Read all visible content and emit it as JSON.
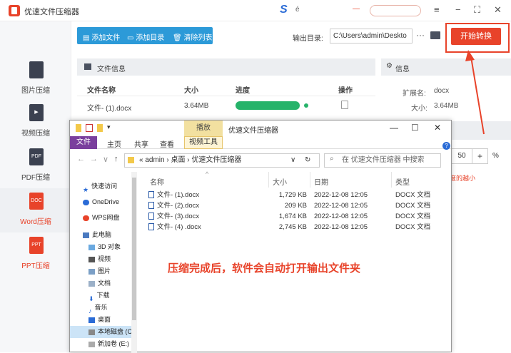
{
  "app": {
    "title": "优速文件压缩器",
    "brand_color": "#e8432a",
    "tb_e_char": "é"
  },
  "window_controls": {
    "menu": "≡",
    "minimize": "−",
    "maximize": "⛶",
    "close": "✕"
  },
  "sidebar": {
    "items": [
      {
        "label": "图片压缩",
        "icon": "image-icon",
        "active": false
      },
      {
        "label": "视频压缩",
        "icon": "video-icon",
        "active": false
      },
      {
        "label": "PDF压缩",
        "icon": "pdf-icon",
        "icon_text": "PDF",
        "active": false
      },
      {
        "label": "Word压缩",
        "icon": "word-icon",
        "icon_text": "DOC",
        "active": true
      },
      {
        "label": "PPT压缩",
        "icon": "ppt-icon",
        "icon_text": "PPT",
        "active": false
      }
    ]
  },
  "toolbar": {
    "add_file": "添加文件",
    "add_dir": "添加目录",
    "clear_list": "清除列表",
    "output_label": "输出目录:",
    "output_path": "C:\\Users\\admin\\Deskto",
    "more": "···",
    "start_button": "开始转换"
  },
  "file_panel": {
    "title": "文件信息",
    "columns": [
      "文件名称",
      "大小",
      "进度",
      "操作"
    ],
    "rows": [
      {
        "name": "文件- (1).docx",
        "size": "3.64MB",
        "progress": 1.0
      }
    ]
  },
  "info_panel": {
    "title": "信息",
    "ext_label": "扩展名:",
    "ext_value": "docx",
    "size_label": "大小:",
    "size_value": "3.64MB",
    "level_value": "50",
    "plus": "+",
    "percent": "%",
    "hint": "度的越小",
    "help": "?"
  },
  "explorer": {
    "title": "优速文件压缩器",
    "manage_tab": "播放",
    "tabs": [
      "文件",
      "主页",
      "共享",
      "查看",
      "视频工具"
    ],
    "address": [
      "«",
      "admin",
      "›",
      "桌面",
      "›",
      "优速文件压缩器"
    ],
    "search_placeholder": "在 优速文件压缩器 中搜索",
    "nav": [
      {
        "label": "快速访问",
        "icon": "star-icon"
      },
      {
        "label": "OneDrive",
        "icon": "cloud-icon"
      },
      {
        "label": "WPS网盘",
        "icon": "wps-cloud-icon"
      },
      {
        "label": "此电脑",
        "icon": "computer-icon"
      },
      {
        "label": "3D 对象",
        "icon": "cube-icon"
      },
      {
        "label": "视频",
        "icon": "video-folder-icon"
      },
      {
        "label": "图片",
        "icon": "picture-folder-icon"
      },
      {
        "label": "文档",
        "icon": "document-folder-icon"
      },
      {
        "label": "下载",
        "icon": "download-icon"
      },
      {
        "label": "音乐",
        "icon": "music-icon"
      },
      {
        "label": "桌面",
        "icon": "desktop-icon"
      },
      {
        "label": "本地磁盘 (C",
        "icon": "drive-icon",
        "selected": true
      },
      {
        "label": "新加卷 (E:)",
        "icon": "drive-icon"
      }
    ],
    "columns": [
      "名称",
      "大小",
      "日期",
      "类型"
    ],
    "files": [
      {
        "name": "文件- (1).docx",
        "size": "1,729 KB",
        "date": "2022-12-08 12:05",
        "type": "DOCX 文档"
      },
      {
        "name": "文件- (2).docx",
        "size": "209 KB",
        "date": "2022-12-08 12:05",
        "type": "DOCX 文档"
      },
      {
        "name": "文件- (3).docx",
        "size": "1,674 KB",
        "date": "2022-12-08 12:05",
        "type": "DOCX 文档"
      },
      {
        "name": "文件- (4) .docx",
        "size": "2,745 KB",
        "date": "2022-12-08 12:05",
        "type": "DOCX 文档"
      }
    ],
    "caption": "压缩完成后，软件会自动打开输出文件夹"
  }
}
